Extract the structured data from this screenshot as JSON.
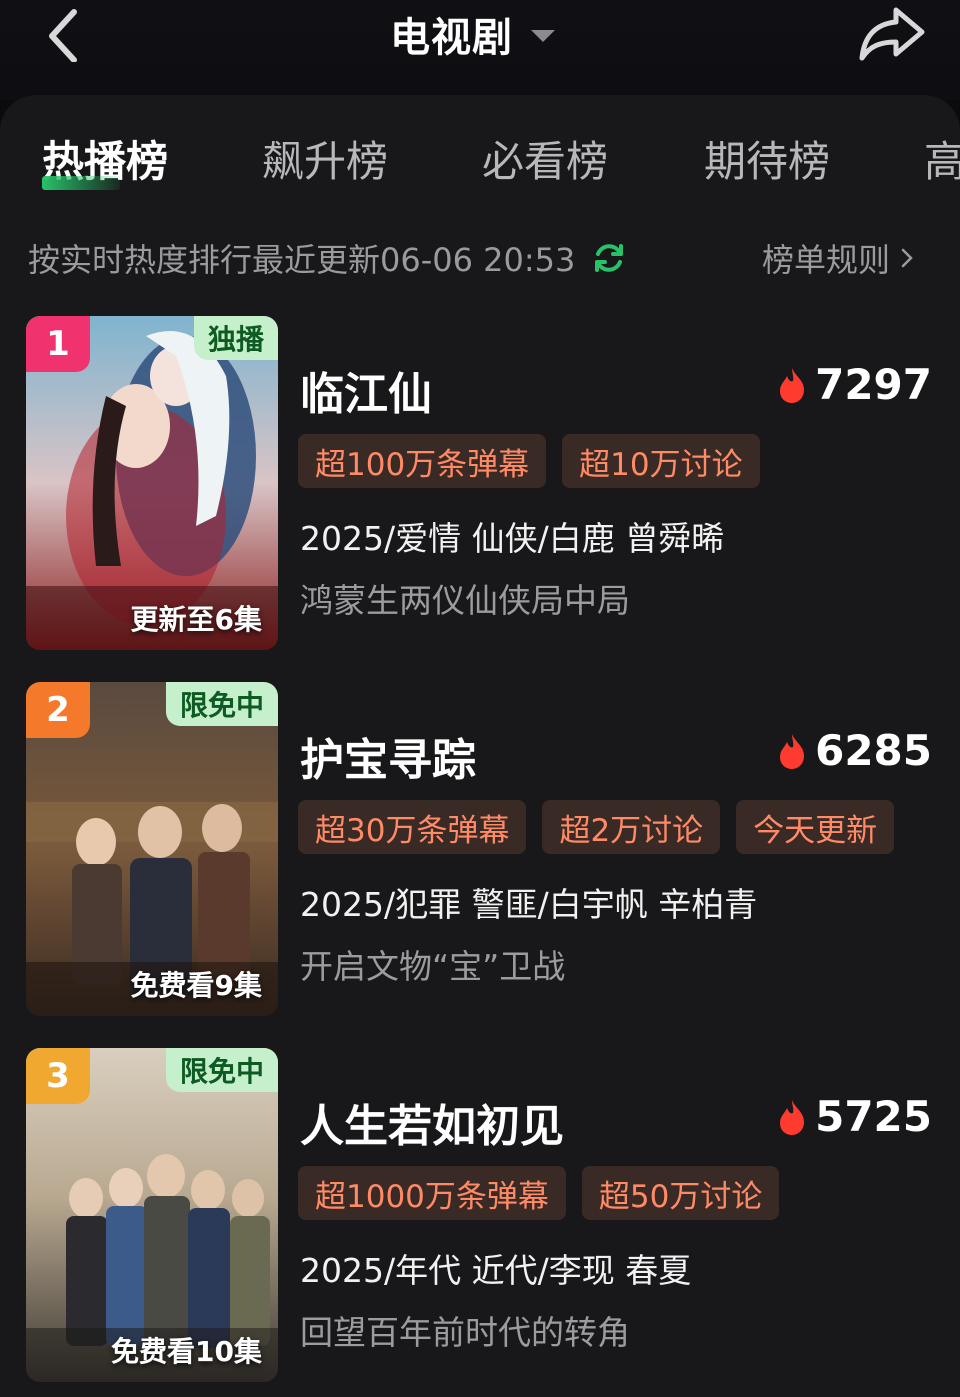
{
  "header": {
    "title": "电视剧",
    "back_icon": "back-chevron-icon",
    "share_icon": "share-arrow-icon"
  },
  "tabs": [
    {
      "label": "热播榜",
      "active": true
    },
    {
      "label": "飙升榜",
      "active": false
    },
    {
      "label": "必看榜",
      "active": false
    },
    {
      "label": "期待榜",
      "active": false
    },
    {
      "label": "高",
      "active": false
    }
  ],
  "status": {
    "text": "按实时热度排行最近更新06-06 20:53",
    "refresh_icon": "refresh-icon",
    "rules_label": "榜单规则"
  },
  "colors": {
    "accent_green": "#27c26a",
    "tag_text": "#ff8a66",
    "tag_bg": "#3a2a25",
    "flame": "#ff3b2f"
  },
  "items": [
    {
      "rank": "1",
      "rank_color": "#f0336e",
      "badge": "独播",
      "episode_label": "更新至6集",
      "title": "临江仙",
      "heat": "7297",
      "tags": [
        "超100万条弹幕",
        "超10万讨论"
      ],
      "meta": "2025/爱情 仙侠/白鹿 曾舜晞",
      "desc": "鸿蒙生两仪仙侠局中局"
    },
    {
      "rank": "2",
      "rank_color": "#f5792b",
      "badge": "限免中",
      "episode_label": "免费看9集",
      "title": "护宝寻踪",
      "heat": "6285",
      "tags": [
        "超30万条弹幕",
        "超2万讨论",
        "今天更新"
      ],
      "meta": "2025/犯罪 警匪/白宇帆 辛柏青",
      "desc": "开启文物“宝”卫战"
    },
    {
      "rank": "3",
      "rank_color": "#f0a830",
      "badge": "限免中",
      "episode_label": "免费看10集",
      "title": "人生若如初见",
      "heat": "5725",
      "tags": [
        "超1000万条弹幕",
        "超50万讨论"
      ],
      "meta": "2025/年代 近代/李现 春夏",
      "desc": "回望百年前时代的转角"
    }
  ]
}
